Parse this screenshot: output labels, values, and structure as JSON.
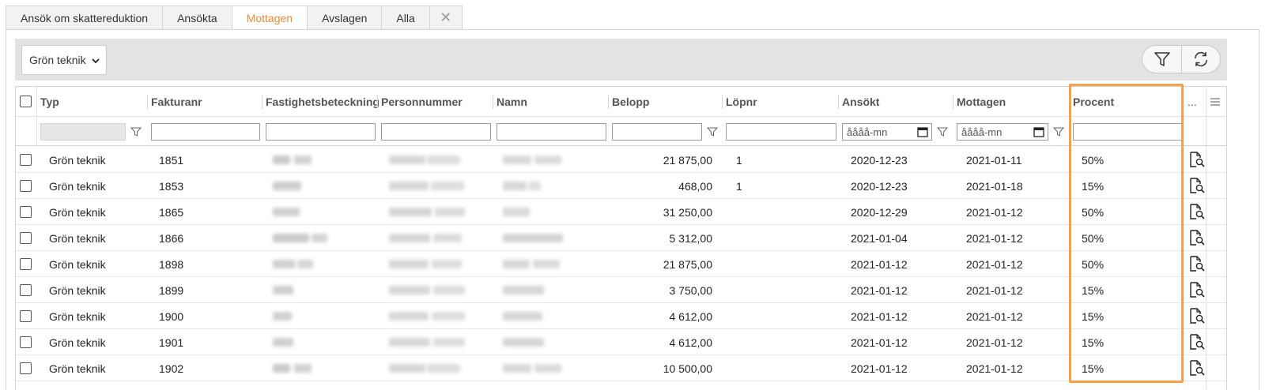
{
  "tabs": [
    {
      "label": "Ansök om skattereduktion",
      "active": false
    },
    {
      "label": "Ansökta",
      "active": false
    },
    {
      "label": "Mottagen",
      "active": true
    },
    {
      "label": "Avslagen",
      "active": false
    },
    {
      "label": "Alla",
      "active": false
    }
  ],
  "tab_close_glyph": "✕",
  "toolbar": {
    "type_filter_value": "Grön teknik",
    "filter_button_icon": "funnel-icon",
    "refresh_button_icon": "refresh-icon"
  },
  "columns": {
    "typ": "Typ",
    "fakturanr": "Fakturanr",
    "fastighetsbeteckning": "Fastighetsbeteckning",
    "personnummer": "Personnummer",
    "namn": "Namn",
    "belopp": "Belopp",
    "lopnr": "Löpnr",
    "ansokt": "Ansökt",
    "mottagen": "Mottagen",
    "procent": "Procent",
    "more": "...",
    "menu_icon": "hamburger-menu-icon"
  },
  "filters": {
    "date_placeholder": "åååå-mn"
  },
  "rows": [
    {
      "typ": "Grön teknik",
      "fakturanr": "1851",
      "belopp": "21 875,00",
      "lopnr": "1",
      "ansokt": "2020-12-23",
      "mottagen": "2021-01-11",
      "procent": "50%"
    },
    {
      "typ": "Grön teknik",
      "fakturanr": "1853",
      "belopp": "468,00",
      "lopnr": "1",
      "ansokt": "2020-12-23",
      "mottagen": "2021-01-18",
      "procent": "15%"
    },
    {
      "typ": "Grön teknik",
      "fakturanr": "1865",
      "belopp": "31 250,00",
      "lopnr": "",
      "ansokt": "2020-12-29",
      "mottagen": "2021-01-12",
      "procent": "50%"
    },
    {
      "typ": "Grön teknik",
      "fakturanr": "1866",
      "belopp": "5 312,00",
      "lopnr": "",
      "ansokt": "2021-01-04",
      "mottagen": "2021-01-12",
      "procent": "50%"
    },
    {
      "typ": "Grön teknik",
      "fakturanr": "1898",
      "belopp": "21 875,00",
      "lopnr": "",
      "ansokt": "2021-01-12",
      "mottagen": "2021-01-12",
      "procent": "50%"
    },
    {
      "typ": "Grön teknik",
      "fakturanr": "1899",
      "belopp": "3 750,00",
      "lopnr": "",
      "ansokt": "2021-01-12",
      "mottagen": "2021-01-12",
      "procent": "15%"
    },
    {
      "typ": "Grön teknik",
      "fakturanr": "1900",
      "belopp": "4 612,00",
      "lopnr": "",
      "ansokt": "2021-01-12",
      "mottagen": "2021-01-12",
      "procent": "15%"
    },
    {
      "typ": "Grön teknik",
      "fakturanr": "1901",
      "belopp": "4 612,00",
      "lopnr": "",
      "ansokt": "2021-01-12",
      "mottagen": "2021-01-12",
      "procent": "15%"
    },
    {
      "typ": "Grön teknik",
      "fakturanr": "1902",
      "belopp": "10 500,00",
      "lopnr": "",
      "ansokt": "2021-01-12",
      "mottagen": "2021-01-12",
      "procent": "15%"
    }
  ],
  "row_action_icon": "document-search-icon",
  "colors": {
    "active_tab": "#e8893a",
    "highlight": "#f5a04a"
  }
}
